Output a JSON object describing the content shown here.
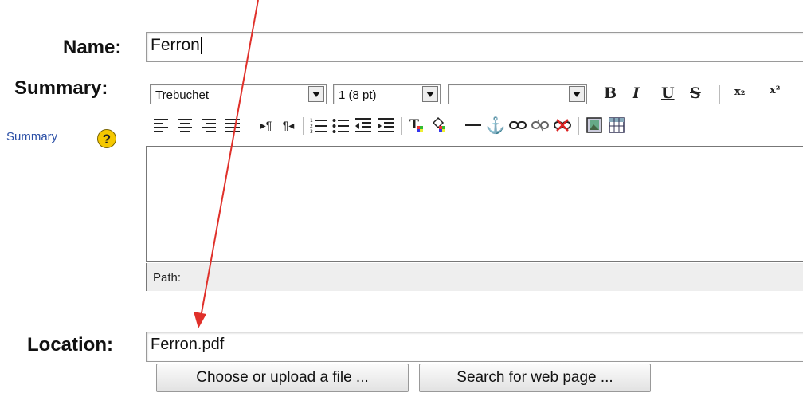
{
  "form": {
    "name_label": "Name:",
    "name_value": "Ferron",
    "summary_label": "Summary:",
    "summary_help_link": "Summary",
    "help_icon_text": "?",
    "location_label": "Location:",
    "location_value": "Ferron.pdf"
  },
  "editor": {
    "font_family": "Trebuchet",
    "font_size": "1 (8 pt)",
    "format": "",
    "path_label": "Path:",
    "content": ""
  },
  "buttons": {
    "choose_file": "Choose or upload a file ...",
    "search_web": "Search for web page ..."
  },
  "toolbar": {
    "bold": "B",
    "italic": "I",
    "underline": "U",
    "strike": "S",
    "subscript": "x₂",
    "superscript": "x²"
  },
  "colors": {
    "arrow": "#e0302a",
    "link": "#2b4fa6",
    "help_icon": "#f5c800"
  }
}
